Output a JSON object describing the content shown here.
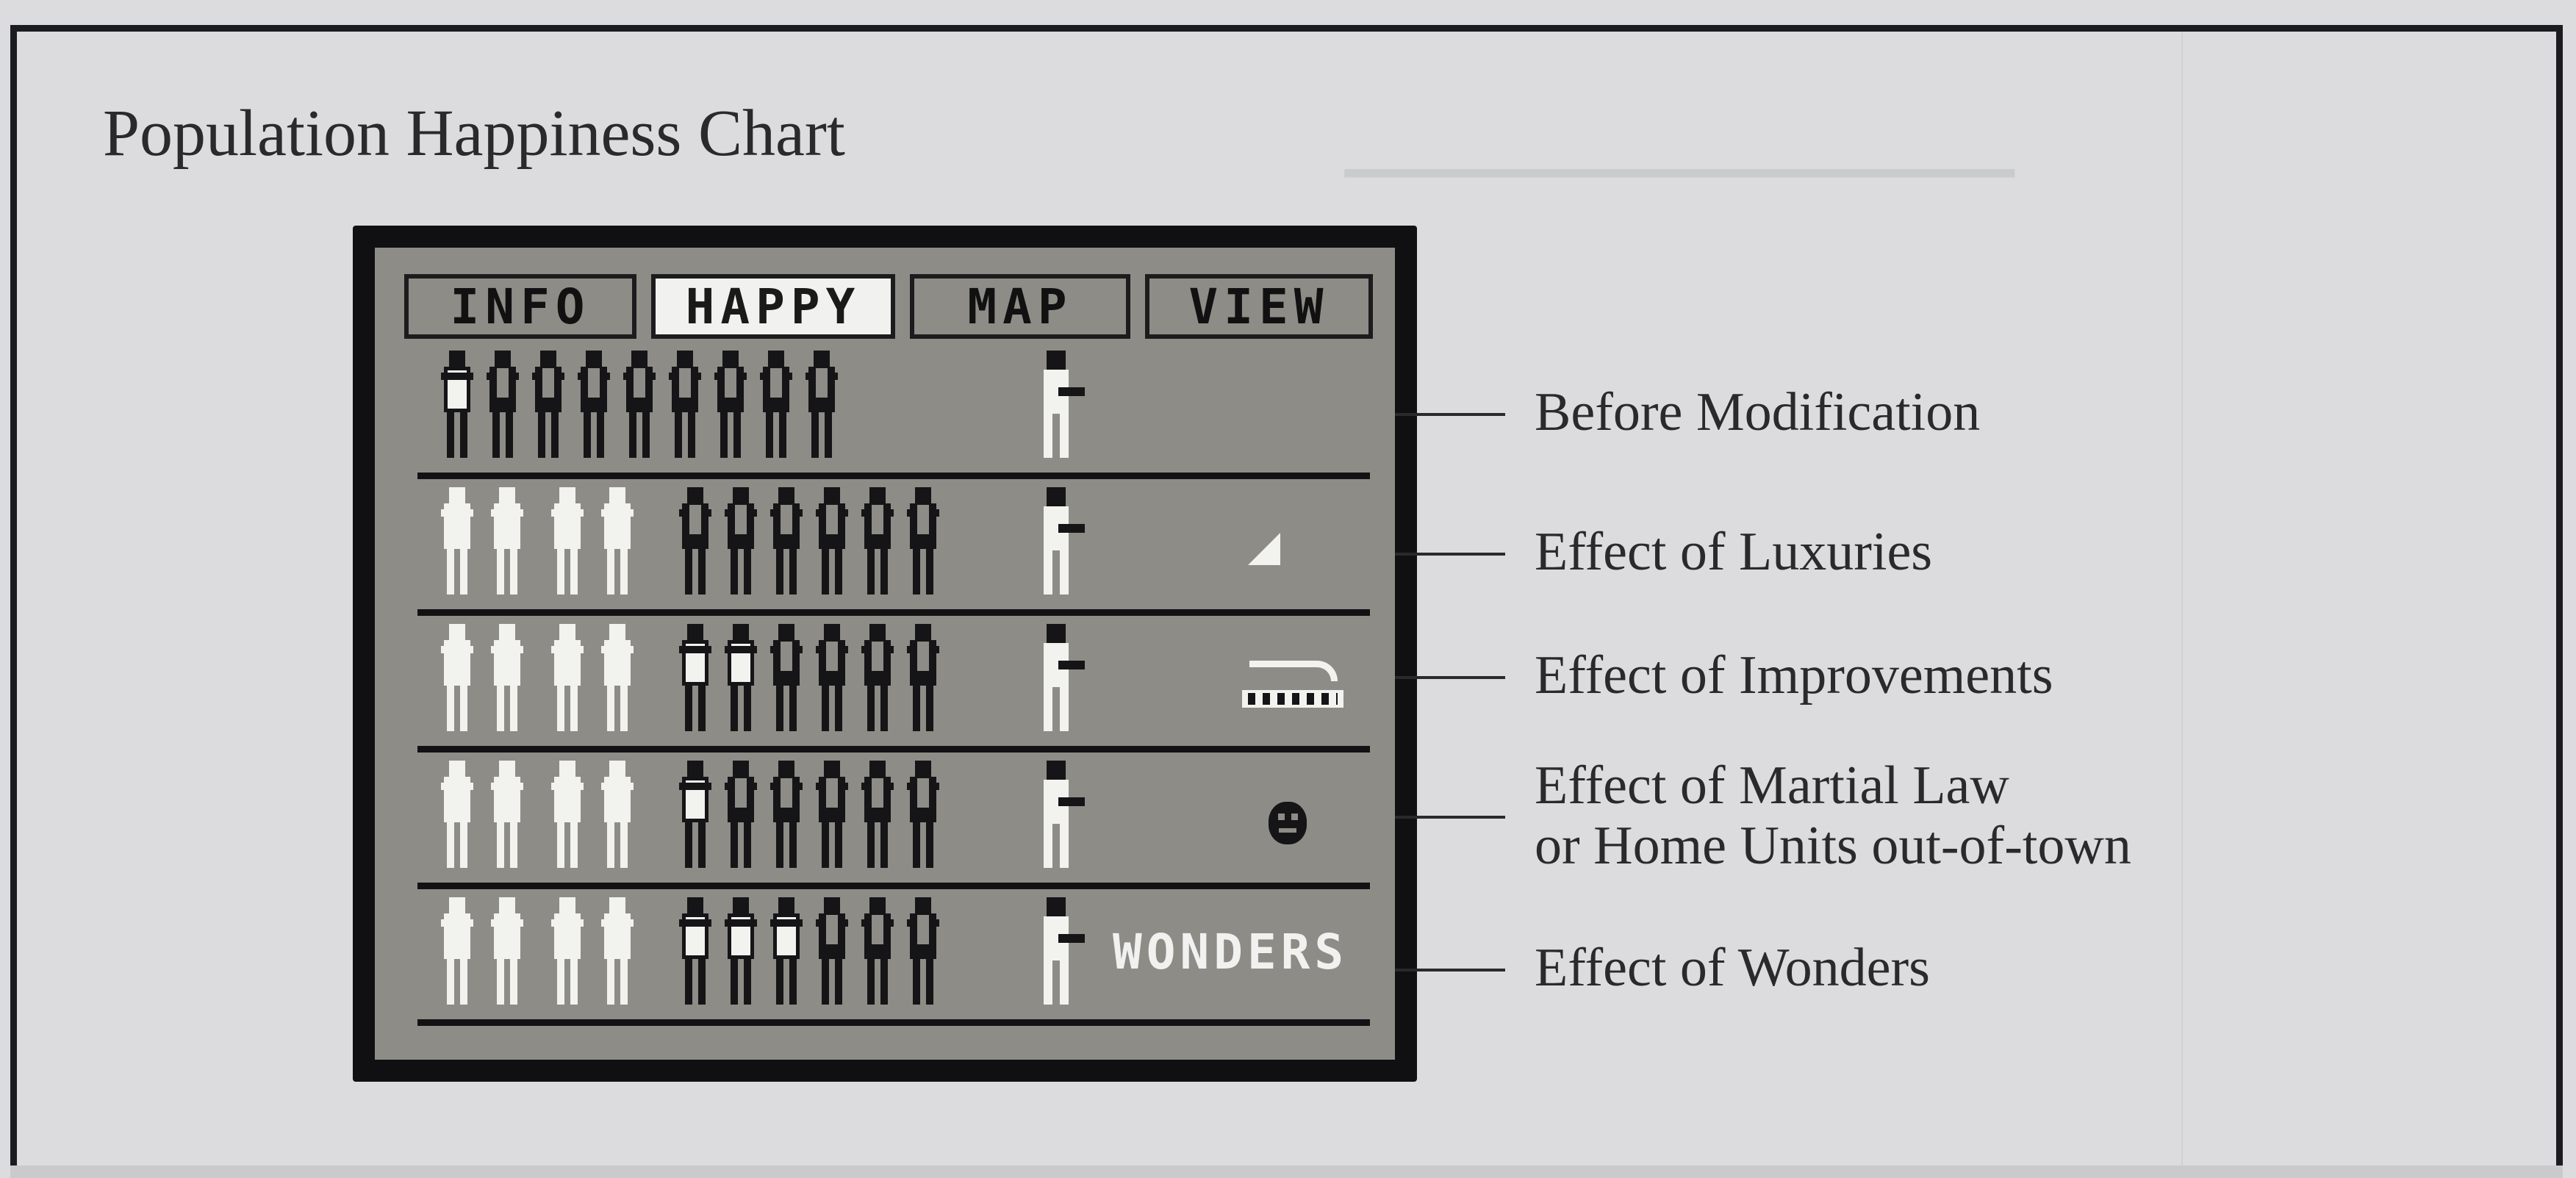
{
  "title": "Population Happiness Chart",
  "tabs": [
    {
      "label": "INFO",
      "active": false
    },
    {
      "label": "HAPPY",
      "active": true
    },
    {
      "label": "MAP",
      "active": false
    },
    {
      "label": "VIEW",
      "active": false
    }
  ],
  "rows": [
    {
      "label": "Before Modification",
      "icon": "none",
      "citizens": {
        "happy": 0,
        "content": 1,
        "unhappy": 8
      }
    },
    {
      "label": "Effect of Luxuries",
      "icon": "luxury-triangle-icon",
      "citizens": {
        "happy": 4,
        "content": 0,
        "unhappy": 6
      }
    },
    {
      "label": "Effect of Improvements",
      "icon": "temple-icon",
      "citizens": {
        "happy": 4,
        "content": 2,
        "unhappy": 4
      }
    },
    {
      "label": "Effect of Martial Law",
      "label_line2": "or Home Units out-of-town",
      "icon": "frowning-face-icon",
      "citizens": {
        "happy": 4,
        "content": 1,
        "unhappy": 5
      }
    },
    {
      "label": "Effect of Wonders",
      "icon": "wonders-label",
      "icon_text": "WONDERS",
      "citizens": {
        "happy": 4,
        "content": 3,
        "unhappy": 3
      }
    }
  ],
  "colors": {
    "screen_bg": "#8d8c87",
    "ink": "#151517",
    "highlight": "#f2f2ef"
  }
}
